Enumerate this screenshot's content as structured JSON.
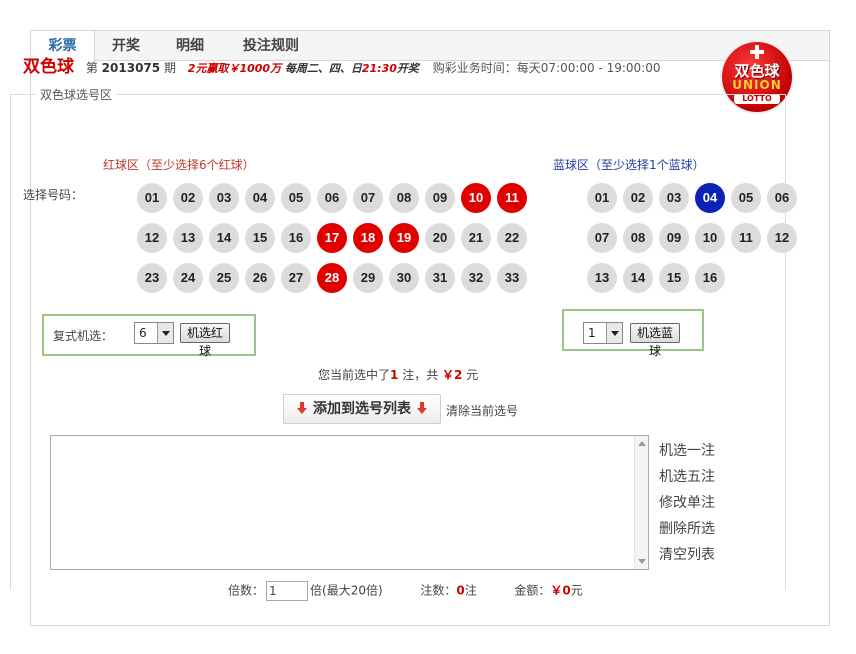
{
  "tabs": [
    {
      "label": "彩票",
      "active": true
    },
    {
      "label": "开奖",
      "active": false
    },
    {
      "label": "明细",
      "active": false
    },
    {
      "label": "投注规则",
      "active": false
    }
  ],
  "header": {
    "game_title": "双色球",
    "issue_prefix": "第",
    "issue_number": "2013075",
    "issue_suffix": "期",
    "promo": "2元赢取￥1000万",
    "schedule_days": "每周二、四、日",
    "schedule_time": "21:30",
    "schedule_suffix": "开奖",
    "business_hours": "购彩业务时间：每天07:00:00 - 19:00:00"
  },
  "logo": {
    "line1": "双色球",
    "line2": "UNION",
    "line3": "LOTTO"
  },
  "section_legend": "双色球选号区",
  "red_zone": {
    "title": "红球区（至少选择6个红球）",
    "balls": [
      "01",
      "02",
      "03",
      "04",
      "05",
      "06",
      "07",
      "08",
      "09",
      "10",
      "11",
      "12",
      "13",
      "14",
      "15",
      "16",
      "17",
      "18",
      "19",
      "20",
      "21",
      "22",
      "23",
      "24",
      "25",
      "26",
      "27",
      "28",
      "29",
      "30",
      "31",
      "32",
      "33"
    ],
    "selected": [
      "10",
      "11",
      "17",
      "18",
      "19",
      "28"
    ]
  },
  "blue_zone": {
    "title": "蓝球区（至少选择1个蓝球）",
    "balls": [
      "01",
      "02",
      "03",
      "04",
      "05",
      "06",
      "07",
      "08",
      "09",
      "10",
      "11",
      "12",
      "13",
      "14",
      "15",
      "16"
    ],
    "selected": [
      "04"
    ]
  },
  "pick_label": "选择号码：",
  "red_machine": {
    "label": "复式机选：",
    "value": "6",
    "button": "机选红球"
  },
  "blue_machine": {
    "value": "1",
    "button": "机选蓝球"
  },
  "summary": {
    "prefix": "您当前选中了",
    "count": "1",
    "mid": "注，共",
    "amount": "￥2",
    "suffix": "元"
  },
  "add_button": "添加到选号列表",
  "clear_current": "清除当前选号",
  "actions": [
    "机选一注",
    "机选五注",
    "修改单注",
    "删除所选",
    "清空列表"
  ],
  "footer": {
    "multiple_label": "倍数：",
    "multiple_value": "1",
    "multiple_suffix": "倍(最大20倍)",
    "bets_label": "注数：",
    "bets_value": "0",
    "bets_suffix": "注",
    "amount_label": "金额：",
    "amount_value": "￥0",
    "amount_suffix": "元"
  },
  "colors": {
    "accent_red": "#d00000",
    "selected_blue": "#0b22b7",
    "tab_active": "#2a6ca8",
    "box_border": "#9bc58b"
  }
}
